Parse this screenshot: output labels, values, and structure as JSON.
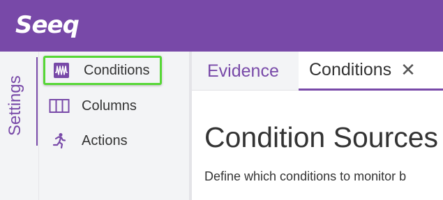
{
  "app": {
    "logo_text": "Seeq",
    "brand_color": "#7849a8",
    "highlight_color": "#56d736"
  },
  "settings": {
    "label": "Settings"
  },
  "nav": {
    "items": [
      {
        "label": "Conditions",
        "icon": "conditions-waveform-icon",
        "selected": true
      },
      {
        "label": "Columns",
        "icon": "columns-icon",
        "selected": false
      },
      {
        "label": "Actions",
        "icon": "running-person-icon",
        "selected": false
      }
    ]
  },
  "tabs": [
    {
      "label": "Evidence",
      "active": false
    },
    {
      "label": "Conditions",
      "active": true,
      "close_icon": "close-icon"
    }
  ],
  "content": {
    "heading": "Condition Sources",
    "description": "Define which conditions to monitor b"
  }
}
